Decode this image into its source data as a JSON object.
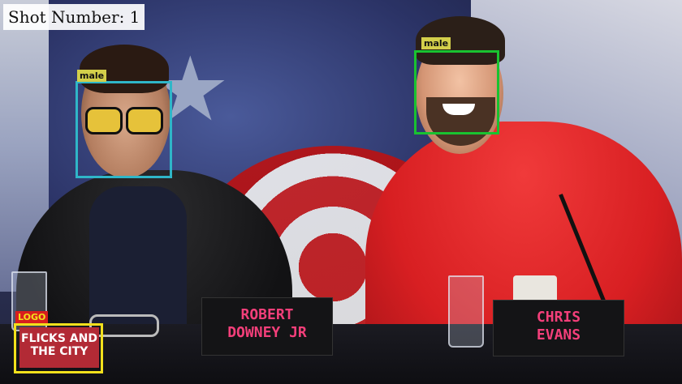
{
  "overlay": {
    "shot_label": "Shot Number: 1"
  },
  "detections": [
    {
      "label": "male",
      "color": "#2fb6c8",
      "tag_color": "#d3cf4a"
    },
    {
      "label": "male",
      "color": "#19c230",
      "tag_color": "#d3cf4a"
    },
    {
      "label": "LOGO",
      "color": "#f2e01c",
      "tag_color": "#d81e1e"
    }
  ],
  "scene": {
    "nameplates": [
      {
        "line1": "ROBERT",
        "line2": "DOWNEY JR"
      },
      {
        "line1": "CHRIS",
        "line2": "EVANS"
      }
    ],
    "logo_text": "FLICKS AND THE CITY"
  }
}
